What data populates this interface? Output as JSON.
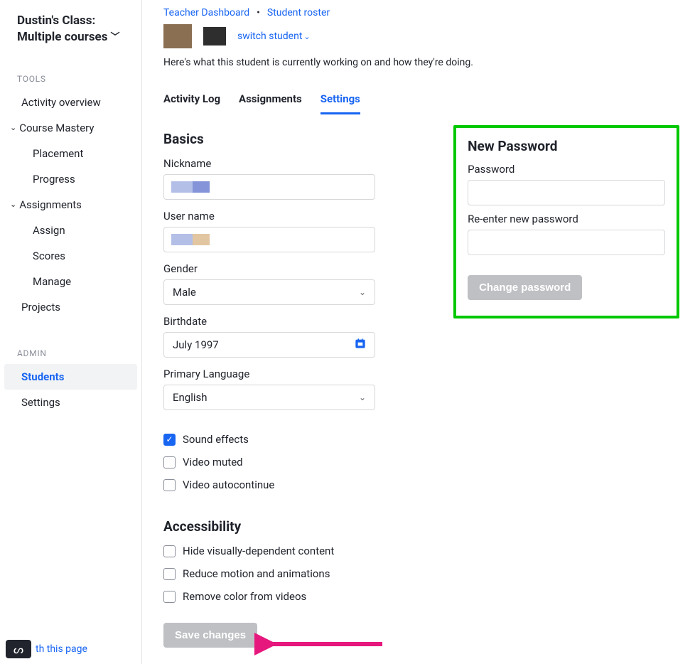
{
  "sidebar": {
    "class_title_line1": "Dustin's Class:",
    "class_title_line2": "Multiple courses",
    "sections": {
      "tools_label": "TOOLS",
      "admin_label": "ADMIN"
    },
    "items": {
      "activity_overview": "Activity overview",
      "course_mastery": "Course Mastery",
      "placement": "Placement",
      "progress": "Progress",
      "assignments": "Assignments",
      "assign": "Assign",
      "scores": "Scores",
      "manage": "Manage",
      "projects": "Projects",
      "students": "Students",
      "settings": "Settings"
    },
    "help_link": "th this page"
  },
  "breadcrumb": {
    "teacher_dashboard": "Teacher Dashboard",
    "student_roster": "Student roster",
    "switch_student": "switch student"
  },
  "header": {
    "description": "Here's what this student is currently working on and how they're doing."
  },
  "tabs": {
    "activity_log": "Activity Log",
    "assignments": "Assignments",
    "settings": "Settings"
  },
  "basics": {
    "heading": "Basics",
    "nickname_label": "Nickname",
    "username_label": "User name",
    "gender_label": "Gender",
    "gender_value": "Male",
    "birthdate_label": "Birthdate",
    "birthdate_value": "July 1997",
    "language_label": "Primary Language",
    "language_value": "English",
    "sound_effects": "Sound effects",
    "video_muted": "Video muted",
    "video_autocontinue": "Video autocontinue"
  },
  "accessibility": {
    "heading": "Accessibility",
    "hide_visual": "Hide visually-dependent content",
    "reduce_motion": "Reduce motion and animations",
    "remove_color": "Remove color from videos"
  },
  "buttons": {
    "save_changes": "Save changes",
    "change_password": "Change password"
  },
  "password_panel": {
    "heading": "New Password",
    "password_label": "Password",
    "reenter_label": "Re-enter new password"
  }
}
